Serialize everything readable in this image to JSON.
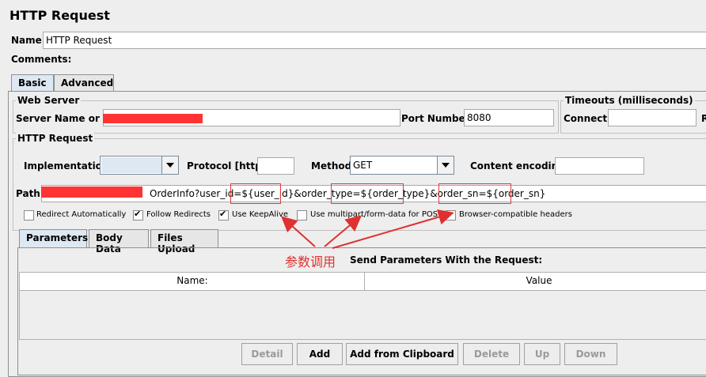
{
  "window": {
    "title": "HTTP Request"
  },
  "name": {
    "label": "Name:",
    "value": "HTTP Request"
  },
  "comments": {
    "label": "Comments:",
    "value": ""
  },
  "top_tabs": [
    "Basic",
    "Advanced"
  ],
  "web_server": {
    "legend": "Web Server",
    "server_label": "Server Name or IP:",
    "server_value": "",
    "port_label": "Port Number:",
    "port_value": "8080"
  },
  "timeouts": {
    "legend": "Timeouts (milliseconds)",
    "connect_label": "Connect:",
    "connect_value": "",
    "response_label": "R"
  },
  "http_request": {
    "legend": "HTTP Request",
    "implementation_label": "Implementation:",
    "implementation_value": "",
    "protocol_label": "Protocol [http]:",
    "protocol_value": "",
    "method_label": "Method:",
    "method_value": "GET",
    "encoding_label": "Content encoding:",
    "encoding_value": ""
  },
  "path": {
    "label": "Path:",
    "visible_text": "OrderInfo?user_id=${user_id}&order_type=${order_type}&order_sn=${order_sn}"
  },
  "checkboxes": [
    {
      "label": "Redirect Automatically",
      "checked": false
    },
    {
      "label": "Follow Redirects",
      "checked": true
    },
    {
      "label": "Use KeepAlive",
      "checked": true
    },
    {
      "label": "Use multipart/form-data for POST",
      "checked": false
    },
    {
      "label": "Browser-compatible headers",
      "checked": false
    }
  ],
  "param_tabs": [
    "Parameters",
    "Body Data",
    "Files Upload"
  ],
  "annotation": "参数调用",
  "params": {
    "title": "Send Parameters With the Request:",
    "columns": [
      "Name:",
      "Value"
    ]
  },
  "buttons": [
    "Detail",
    "Add",
    "Add from Clipboard",
    "Delete",
    "Up",
    "Down"
  ]
}
